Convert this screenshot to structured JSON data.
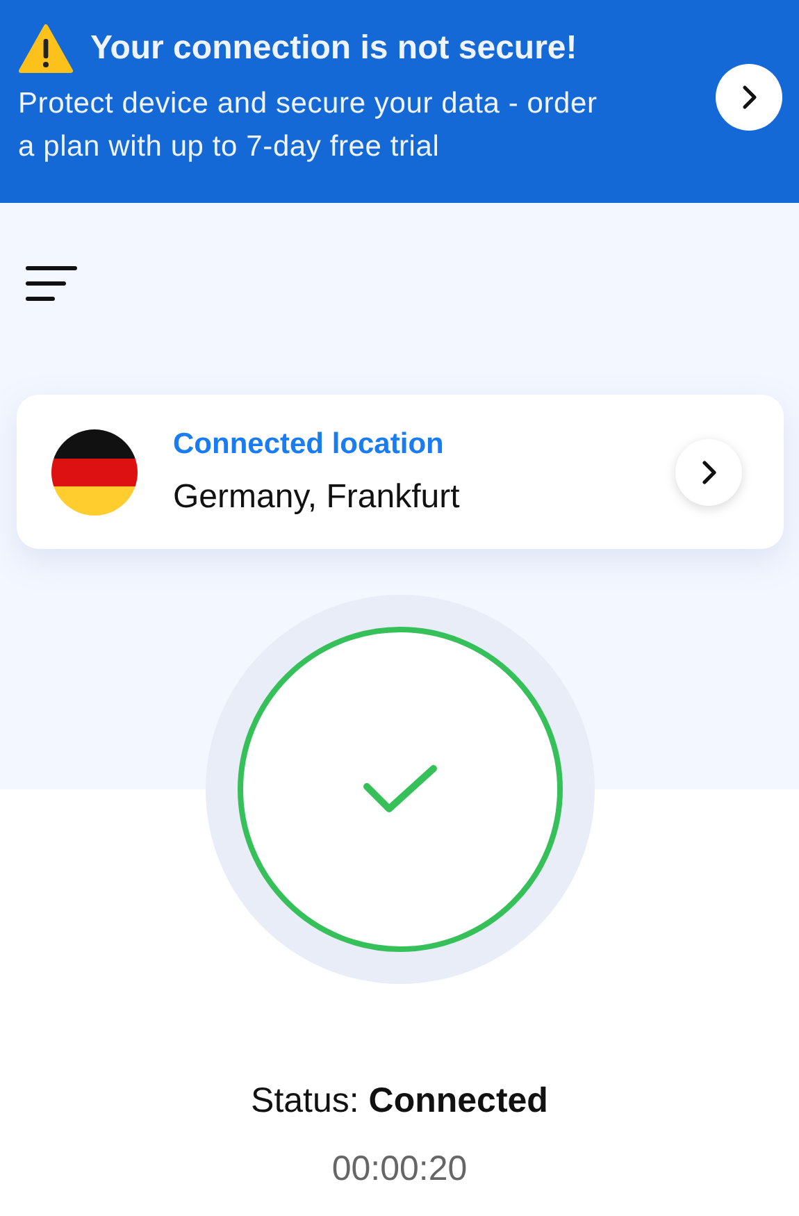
{
  "banner": {
    "title": "Your connection is not secure!",
    "message": "Protect device and secure your data - order a plan with up to 7-day free trial"
  },
  "location": {
    "label": "Connected location",
    "name": "Germany, Frankfurt"
  },
  "connection": {
    "connected": true,
    "status": "Status: **Connected**",
    "timer": "00:00:20"
  }
}
